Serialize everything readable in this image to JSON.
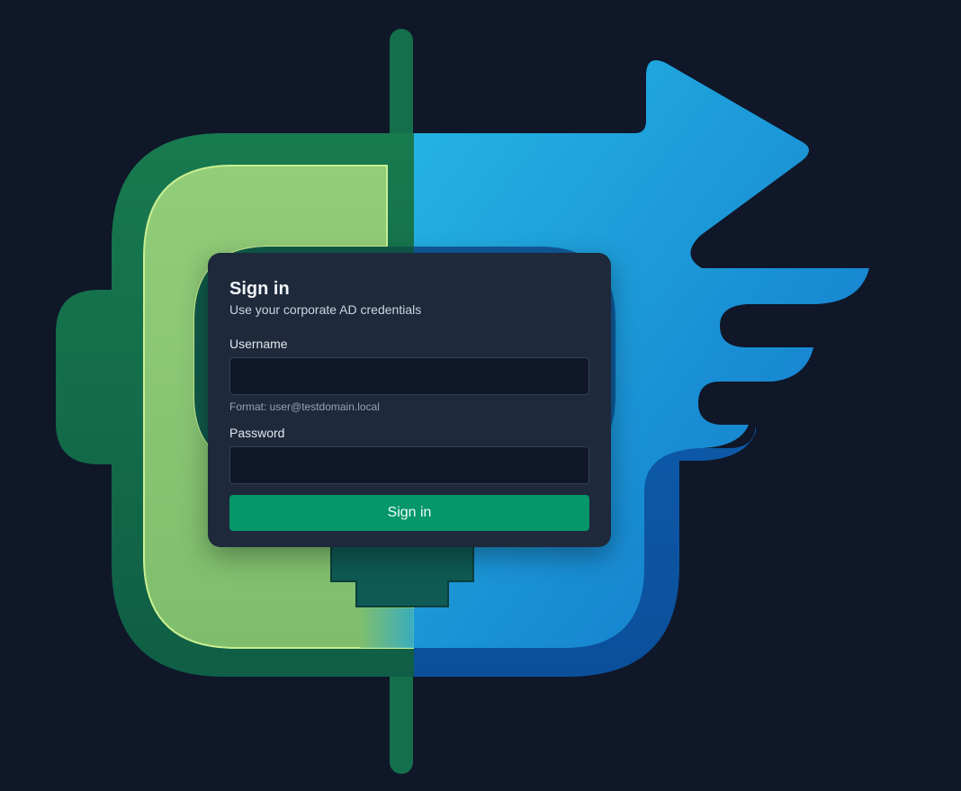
{
  "login": {
    "title": "Sign in",
    "subtitle": "Use your corporate AD credentials",
    "username": {
      "label": "Username",
      "value": "",
      "placeholder": "",
      "hint": "Format: user@testdomain.local"
    },
    "password": {
      "label": "Password",
      "value": "",
      "placeholder": ""
    },
    "submit_label": "Sign in"
  },
  "background_logo": {
    "icon": "brand-logo-icon",
    "colors": {
      "page_background": "#0f1729",
      "green_dark": "#15704a",
      "green_light": "#8cc874",
      "blue_light": "#22b0e2",
      "blue_dark": "#0f5fae",
      "card": "#1e293b",
      "accent_button": "#059669"
    }
  }
}
